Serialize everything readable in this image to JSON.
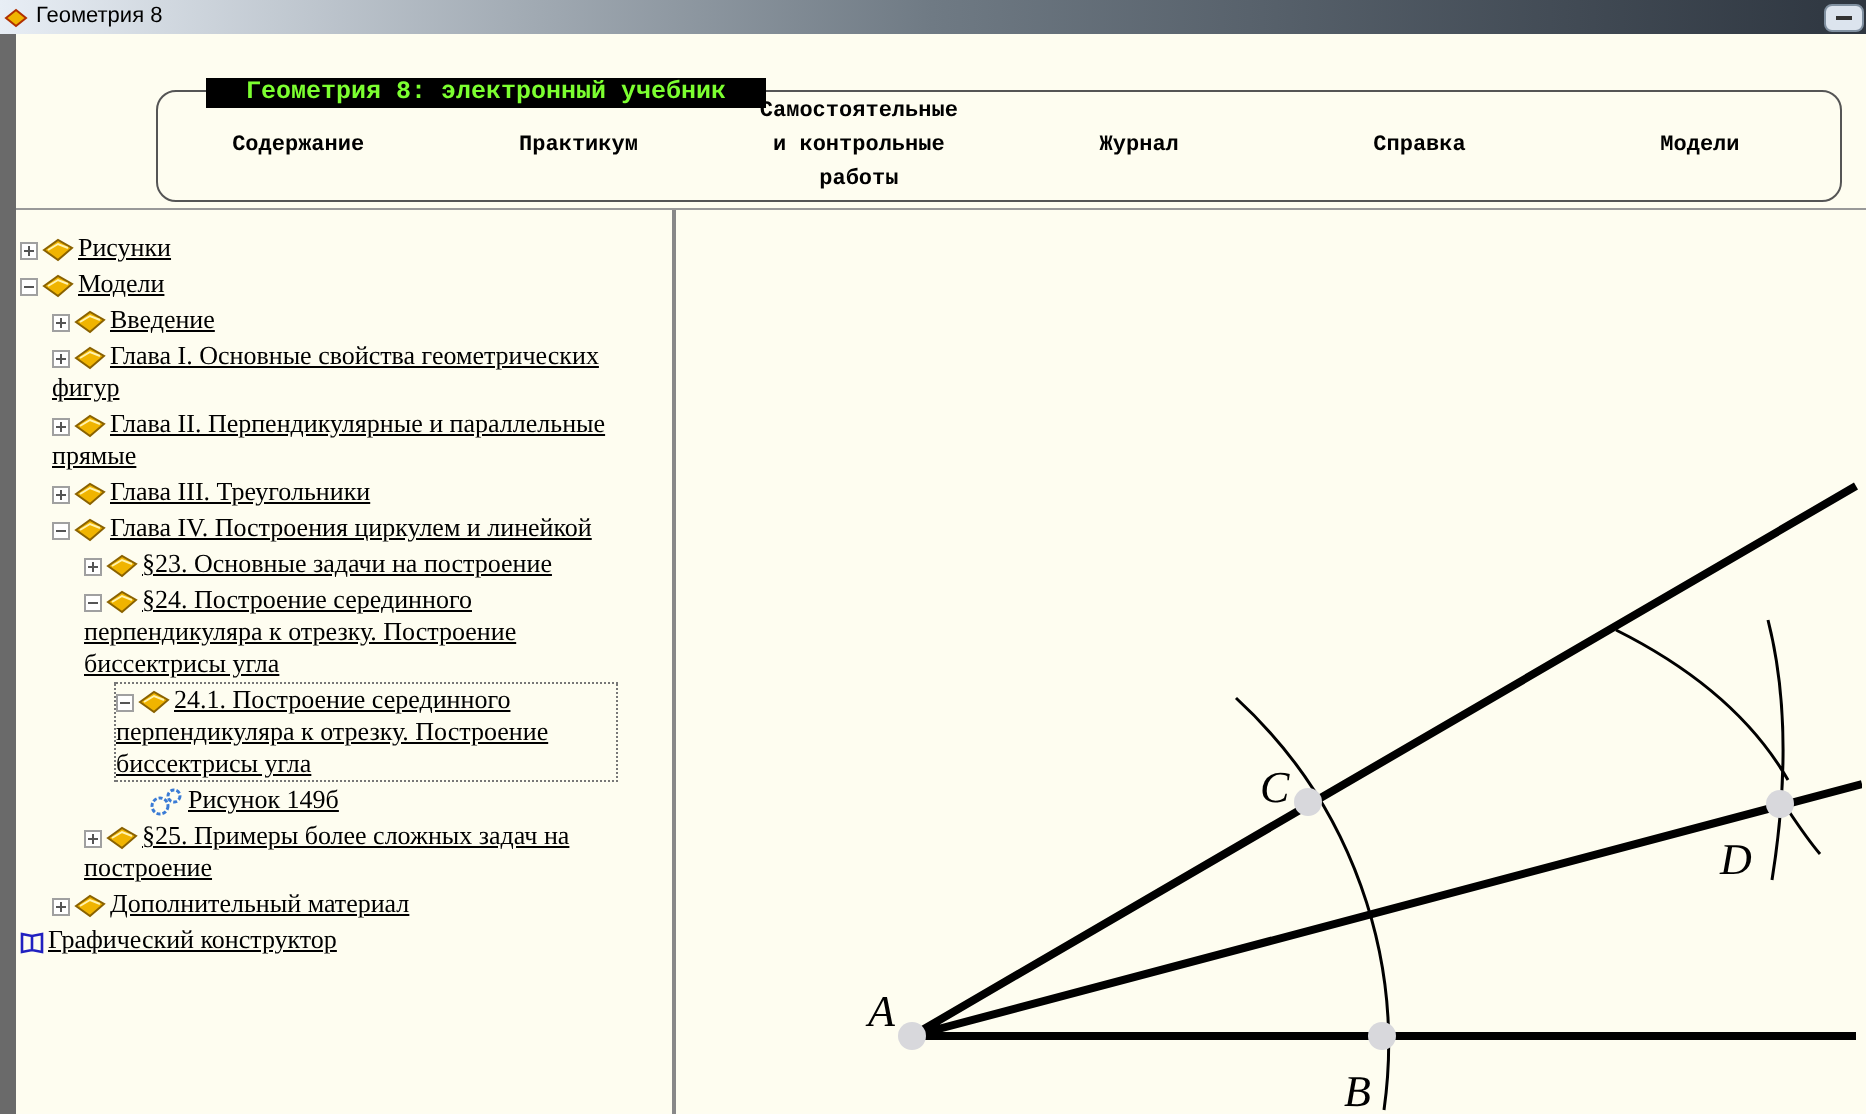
{
  "window": {
    "title": "Геометрия 8"
  },
  "header": {
    "title": "Геометрия 8: электронный учебник",
    "nav": [
      {
        "label": "Содержание"
      },
      {
        "label": "Практикум"
      },
      {
        "label": "Самостоятельные\nи контрольные\nработы"
      },
      {
        "label": "Журнал"
      },
      {
        "label": "Справка"
      },
      {
        "label": "Модели"
      }
    ]
  },
  "tree": [
    {
      "label": "Рисунки",
      "kind": "book",
      "expanded": false,
      "selected": false
    },
    {
      "label": "Модели",
      "kind": "book",
      "expanded": true,
      "selected": false,
      "children": [
        {
          "label": "Введение",
          "kind": "book",
          "expanded": false,
          "selected": false
        },
        {
          "label": "Глава I. Основные свойства геометрических фигур",
          "kind": "book",
          "expanded": false,
          "selected": false
        },
        {
          "label": "Глава II. Перпендикулярные и параллельные прямые",
          "kind": "book",
          "expanded": false,
          "selected": false
        },
        {
          "label": "Глава III. Треугольники",
          "kind": "book",
          "expanded": false,
          "selected": false
        },
        {
          "label": "Глава IV. Построения циркулем и линейкой",
          "kind": "book",
          "expanded": true,
          "selected": false,
          "children": [
            {
              "label": "§23. Основные задачи на построение",
              "kind": "book",
              "expanded": false,
              "selected": false
            },
            {
              "label": "§24. Построение серединного перпендикуляра к отрезку. Построение биссектрисы угла",
              "kind": "book",
              "expanded": true,
              "selected": false,
              "children": [
                {
                  "label": "24.1. Построение серединного перпендикуляра к отрезку. Построение биссектрисы угла",
                  "kind": "book",
                  "expanded": true,
                  "selected": true,
                  "children": [
                    {
                      "label": "Рисунок 149б",
                      "kind": "model",
                      "selected": false
                    }
                  ]
                }
              ]
            },
            {
              "label": "§25. Примеры более сложных задач на построение",
              "kind": "book",
              "expanded": false,
              "selected": false
            }
          ]
        },
        {
          "label": "Дополнительный материал",
          "kind": "book",
          "expanded": false,
          "selected": false
        }
      ]
    },
    {
      "label": "Графический конструктор",
      "kind": "tool",
      "selected": false
    }
  ],
  "figure": {
    "points": [
      {
        "label": "A"
      },
      {
        "label": "B"
      },
      {
        "label": "C"
      },
      {
        "label": "D"
      }
    ]
  }
}
